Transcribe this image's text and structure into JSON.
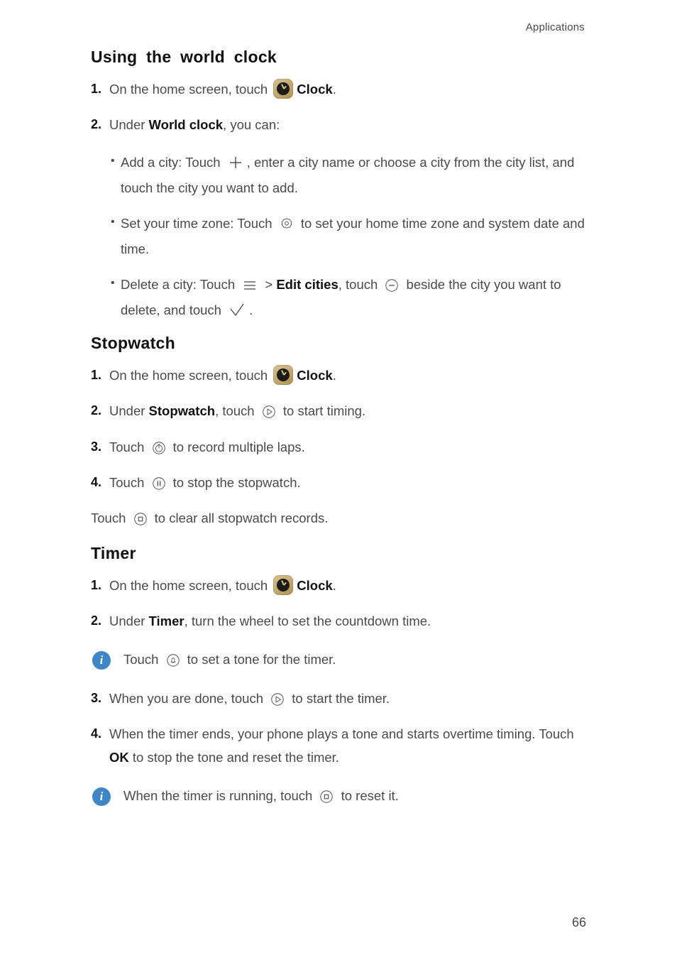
{
  "header": {
    "running_head": "Applications"
  },
  "footer": {
    "page_number": "66"
  },
  "sections": [
    {
      "title": "Using the world clock",
      "steps": [
        {
          "num": "1.",
          "parts": [
            {
              "text": "On the home screen, touch "
            },
            {
              "icon": "clock-app-icon"
            },
            {
              "text": "Clock",
              "bold": true
            },
            {
              "text": "."
            }
          ]
        },
        {
          "num": "2.",
          "parts": [
            {
              "text": "Under "
            },
            {
              "text": "World clock",
              "bold": true
            },
            {
              "text": ", you can:"
            }
          ]
        }
      ],
      "bullets": [
        {
          "parts": [
            {
              "text": "Add a city: Touch "
            },
            {
              "icon": "plus-icon"
            },
            {
              "text": ", enter a city name or choose a city from the city list, and touch the city you want to add."
            }
          ]
        },
        {
          "parts": [
            {
              "text": "Set your time zone: Touch "
            },
            {
              "icon": "gear-icon"
            },
            {
              "text": " to set your home time zone and system date and time."
            }
          ]
        },
        {
          "parts": [
            {
              "text": "Delete a city: Touch "
            },
            {
              "icon": "menu-icon"
            },
            {
              "text": " > "
            },
            {
              "text": "Edit cities",
              "bold": true
            },
            {
              "text": ", touch "
            },
            {
              "icon": "minus-circle-icon"
            },
            {
              "text": " beside the city you want to delete, and touch "
            },
            {
              "icon": "check-icon"
            },
            {
              "text": "."
            }
          ]
        }
      ]
    },
    {
      "title": "Stopwatch",
      "steps": [
        {
          "num": "1.",
          "parts": [
            {
              "text": "On the home screen, touch "
            },
            {
              "icon": "clock-app-icon"
            },
            {
              "text": "Clock",
              "bold": true
            },
            {
              "text": "."
            }
          ]
        },
        {
          "num": "2.",
          "parts": [
            {
              "text": "Under "
            },
            {
              "text": "Stopwatch",
              "bold": true
            },
            {
              "text": ", touch "
            },
            {
              "icon": "play-circle-icon"
            },
            {
              "text": " to start timing."
            }
          ]
        },
        {
          "num": "3.",
          "parts": [
            {
              "text": "Touch "
            },
            {
              "icon": "lap-circle-icon"
            },
            {
              "text": " to record multiple laps."
            }
          ]
        },
        {
          "num": "4.",
          "parts": [
            {
              "text": "Touch "
            },
            {
              "icon": "pause-circle-icon"
            },
            {
              "text": " to stop the stopwatch."
            }
          ]
        }
      ],
      "plain_line": {
        "parts": [
          {
            "text": "Touch "
          },
          {
            "icon": "stop-circle-icon"
          },
          {
            "text": " to clear all stopwatch records."
          }
        ]
      }
    },
    {
      "title": "Timer",
      "steps": [
        {
          "num": "1.",
          "parts": [
            {
              "text": "On the home screen, touch "
            },
            {
              "icon": "clock-app-icon"
            },
            {
              "text": "Clock",
              "bold": true
            },
            {
              "text": "."
            }
          ]
        },
        {
          "num": "2.",
          "parts": [
            {
              "text": "Under "
            },
            {
              "text": "Timer",
              "bold": true
            },
            {
              "text": ", turn the wheel to set the countdown time."
            }
          ]
        },
        {
          "num": "3.",
          "parts": [
            {
              "text": "When you are done, touch "
            },
            {
              "icon": "play-circle-icon"
            },
            {
              "text": " to start the timer."
            }
          ]
        },
        {
          "num": "4.",
          "parts": [
            {
              "text": "When the timer ends, your phone plays a tone and starts overtime timing. Touch "
            },
            {
              "text": "OK",
              "bold": true
            },
            {
              "text": " to stop the tone and reset the timer."
            }
          ]
        }
      ],
      "notes": [
        {
          "icon": "info-icon",
          "parts": [
            {
              "text": "Touch "
            },
            {
              "icon": "bell-circle-icon"
            },
            {
              "text": " to set a tone for the timer."
            }
          ]
        },
        {
          "icon": "info-icon",
          "parts": [
            {
              "text": "When the timer is running, touch "
            },
            {
              "icon": "stop-circle-icon"
            },
            {
              "text": " to reset it."
            }
          ]
        }
      ]
    }
  ],
  "icon_labels": {
    "clock-app-icon": "clock-app-icon",
    "plus-icon": "plus-icon",
    "gear-icon": "gear-icon",
    "menu-icon": "hamburger-menu-icon",
    "minus-circle-icon": "minus-circle-icon",
    "check-icon": "check-icon",
    "play-circle-icon": "play-circle-icon",
    "lap-circle-icon": "lap-circle-icon",
    "pause-circle-icon": "pause-circle-icon",
    "stop-circle-icon": "stop-circle-icon",
    "bell-circle-icon": "bell-circle-icon",
    "info-icon": "info-icon"
  },
  "colors": {
    "info_blue": "#3f86c9",
    "text": "#4a4a4a",
    "heading": "#111111",
    "icon_gold": "#c6ab75"
  }
}
